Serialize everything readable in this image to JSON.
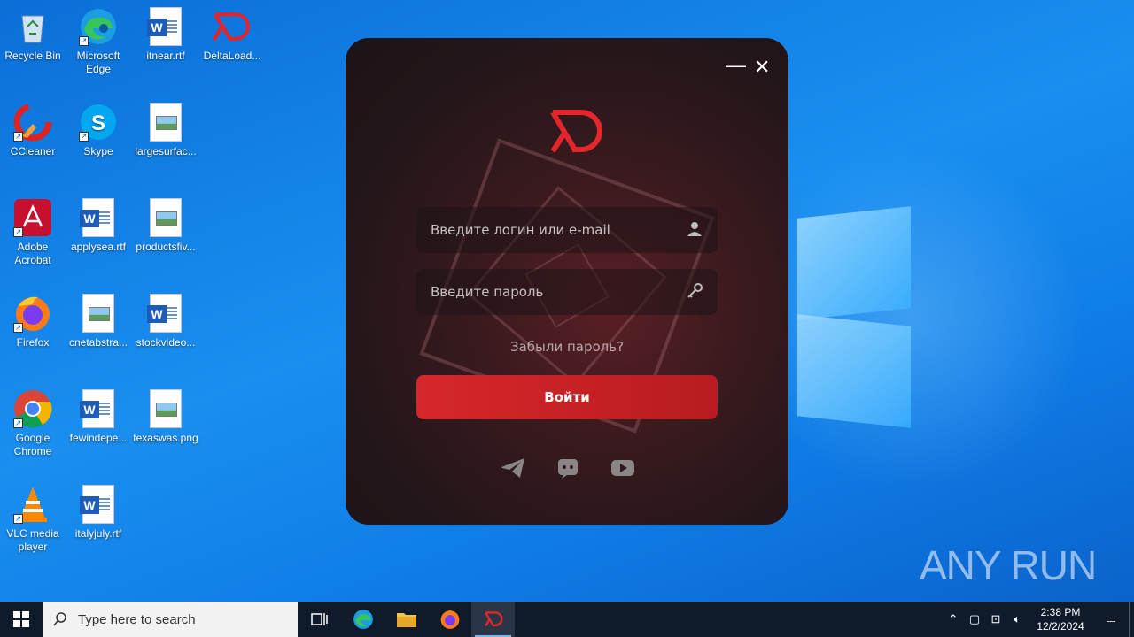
{
  "desktop": {
    "icons": [
      {
        "label": "Recycle Bin"
      },
      {
        "label": "Microsoft Edge"
      },
      {
        "label": "itnear.rtf"
      },
      {
        "label": "DeltaLoad..."
      },
      {
        "label": "CCleaner"
      },
      {
        "label": "Skype"
      },
      {
        "label": "largesurfac..."
      },
      {
        "label": "Adobe Acrobat"
      },
      {
        "label": "applysea.rtf"
      },
      {
        "label": "productsfiv..."
      },
      {
        "label": "Firefox"
      },
      {
        "label": "cnetabstra..."
      },
      {
        "label": "stockvideo..."
      },
      {
        "label": "Google Chrome"
      },
      {
        "label": "fewindepe..."
      },
      {
        "label": "texaswas.png"
      },
      {
        "label": "VLC media player"
      },
      {
        "label": "italyjuly.rtf"
      }
    ]
  },
  "app": {
    "minimize": "—",
    "close": "✕",
    "login_placeholder": "Введите логин или e-mail",
    "password_placeholder": "Введите пароль",
    "forgot": "Забыли пароль?",
    "login_button": "Войти",
    "accent": "#d6272a"
  },
  "watermark": "ANY RUN",
  "taskbar": {
    "search_placeholder": "Type here to search",
    "time": "2:38 PM",
    "date": "12/2/2024"
  }
}
